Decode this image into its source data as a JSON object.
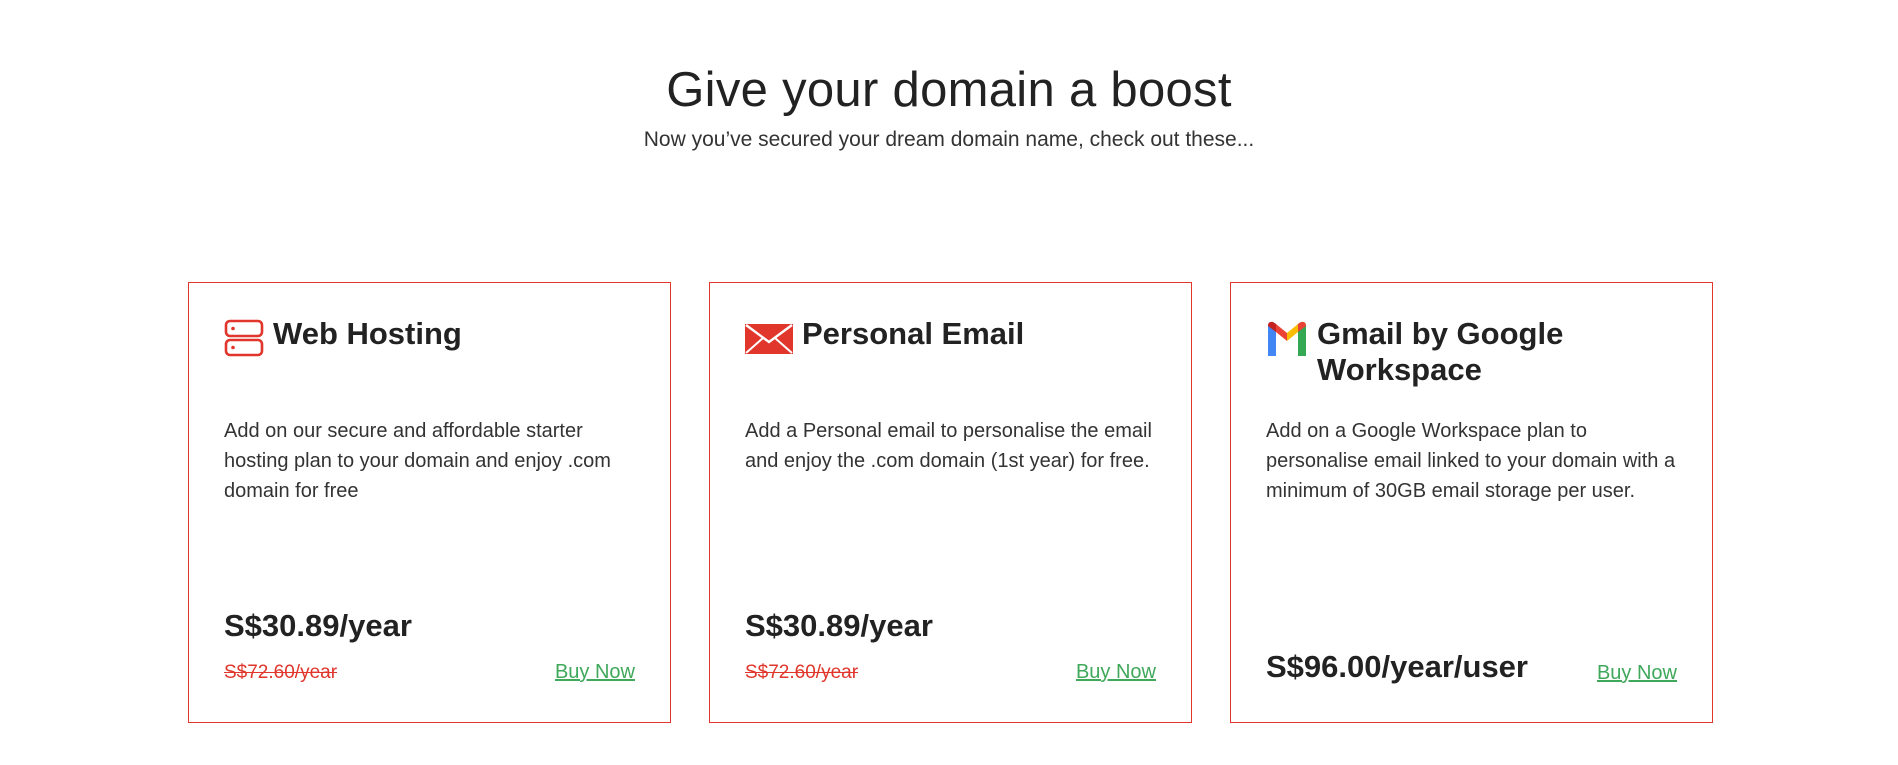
{
  "header": {
    "title": "Give your domain a boost",
    "subtitle": "Now you’ve secured your dream domain name, check out these..."
  },
  "cards": [
    {
      "icon": "server-icon",
      "title": "Web Hosting",
      "description": "Add on our secure and affordable starter hosting plan to your domain and enjoy .com domain for free",
      "price": "S$30.89/year",
      "old_price": "S$72.60/year",
      "cta": "Buy Now"
    },
    {
      "icon": "envelope-icon",
      "title": "Personal Email",
      "description": "Add a Personal email to personalise the email and enjoy the .com domain (1st year) for free.",
      "price": "S$30.89/year",
      "old_price": "S$72.60/year",
      "cta": "Buy Now"
    },
    {
      "icon": "gmail-icon",
      "title": "Gmail by Google Workspace",
      "description": "Add on a Google Workspace plan to personalise email linked to your domain with a minimum of 30GB email storage per user.",
      "price": "S$96.00/year/user",
      "cta": "Buy Now"
    }
  ],
  "colors": {
    "accent_red": "#e0362c",
    "buy_now_green": "#3fa85a",
    "text_dark": "#222222"
  }
}
